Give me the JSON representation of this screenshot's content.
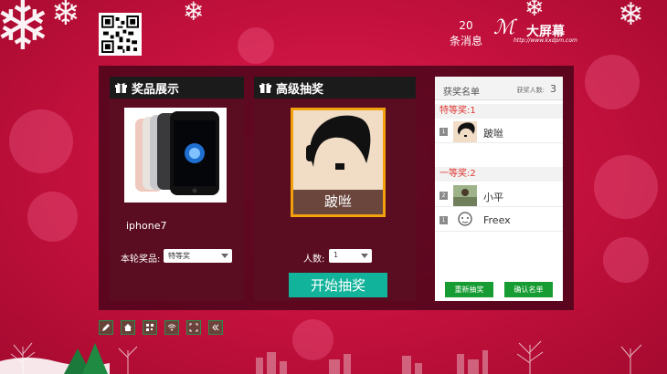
{
  "header": {
    "message_count": "20",
    "message_label": "条消息",
    "logo_name": "大屏幕",
    "logo_url": "http://www.kxdpm.com"
  },
  "prize_panel": {
    "title": "奖品展示",
    "prize_name": "iphone7",
    "round_prize_label": "本轮奖品:",
    "round_prize_value": "特等奖"
  },
  "draw_panel": {
    "title": "高级抽奖",
    "candidate_name": "跛咝",
    "count_label": "人数:",
    "count_value": "1",
    "start_button": "开始抽奖"
  },
  "winners_panel": {
    "title": "获奖名单",
    "count_label": "获奖人数:",
    "count_value": "3",
    "tiers": [
      {
        "label": "特等奖:1",
        "winners": [
          {
            "rank": "1",
            "name": "跛咝"
          }
        ]
      },
      {
        "label": "一等奖:2",
        "winners": [
          {
            "rank": "2",
            "name": "小平"
          },
          {
            "rank": "1",
            "name": "Freex"
          }
        ]
      }
    ],
    "redraw_button": "重新抽奖",
    "confirm_button": "确认名单"
  },
  "toolbar": [
    "edit-icon",
    "home-icon",
    "qrcode-icon",
    "wifi-icon",
    "fullscreen-icon",
    "collapse-icon"
  ],
  "colors": {
    "accent_green": "#12b39b",
    "button_green": "#179c33",
    "tier_red": "#e0362f",
    "frame_orange": "#f0a10c"
  }
}
